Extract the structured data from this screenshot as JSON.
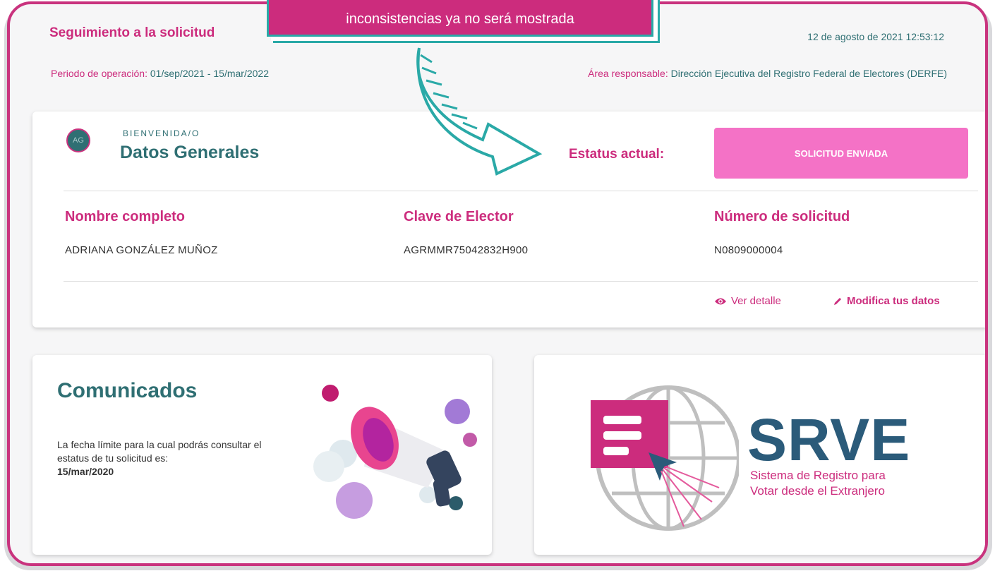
{
  "header": {
    "title": "Seguimiento a la solicitud",
    "datetime": "12 de agosto de 2021 12:53:12",
    "period_label": "Periodo de operación:",
    "period_value": "01/sep/2021 - 15/mar/2022",
    "area_label": "Área responsable:",
    "area_value": "Dirección Ejecutiva del Registro Federal de Electores (DERFE)"
  },
  "banner": {
    "text": "inconsistencias ya no será mostrada"
  },
  "datos": {
    "avatar_initials": "AG",
    "welcome": "BIENVENIDA/O",
    "title": "Datos Generales",
    "status_label": "Estatus actual:",
    "status_value": "SOLICITUD ENVIADA",
    "fields": [
      {
        "label": "Nombre completo",
        "value": "ADRIANA GONZÁLEZ MUÑOZ"
      },
      {
        "label": "Clave de Elector",
        "value": "AGRMMR75042832H900"
      },
      {
        "label": "Número de solicitud",
        "value": "N0809000004"
      }
    ],
    "ver_detalle": "Ver detalle",
    "modifica": "Modifica tus datos"
  },
  "comunicados": {
    "title": "Comunicados",
    "text": "La fecha límite para la cual podrás consultar el estatus de tu solicitud es:",
    "date": "15/mar/2020"
  },
  "srve": {
    "acronym": "SRVE",
    "line1": "Sistema de Registro para",
    "line2": "Votar desde el Extranjero"
  },
  "colors": {
    "brand_pink": "#cc2c7d",
    "brand_teal": "#2f6f73",
    "status_button": "#f472c6",
    "srve_blue": "#2b5b7a"
  },
  "icons": [
    "eye-icon",
    "pencil-icon",
    "megaphone-illustration",
    "globe-icon",
    "document-icon",
    "cursor-icon",
    "arrow-annotation"
  ]
}
